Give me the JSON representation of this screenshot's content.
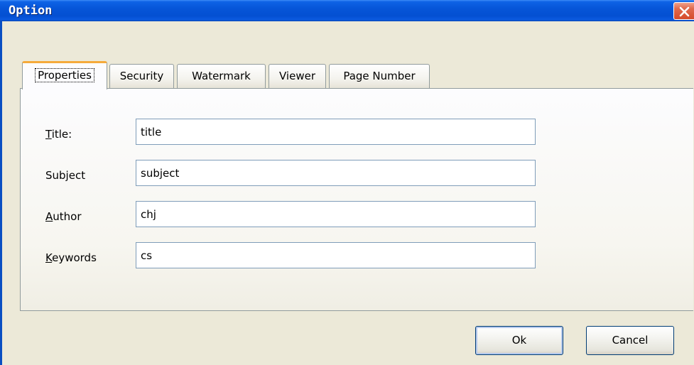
{
  "window": {
    "title": "Option"
  },
  "tabs": [
    {
      "label": "Properties",
      "active": true
    },
    {
      "label": "Security",
      "active": false
    },
    {
      "label": "Watermark",
      "active": false
    },
    {
      "label": "Viewer",
      "active": false
    },
    {
      "label": "Page Number",
      "active": false
    }
  ],
  "fields": [
    {
      "label": "Title:",
      "mnemonic": "T",
      "rest": "itle:",
      "value": "title"
    },
    {
      "label": "Subject",
      "mnemonic": "",
      "rest": "Subject",
      "value": "subject"
    },
    {
      "label": "Author",
      "mnemonic": "A",
      "rest": "uthor",
      "value": "chj"
    },
    {
      "label": "Keywords",
      "mnemonic": "K",
      "rest": "eywords",
      "value": "cs"
    }
  ],
  "buttons": {
    "ok_label": "Ok",
    "cancel_label": "Cancel"
  },
  "icons": {
    "close": "close-icon"
  },
  "colors": {
    "titlebar": "#0655d8",
    "active_tab_accent": "#f5aa3a",
    "close_button": "#d54a2a",
    "dialog_background": "#ece9d8"
  }
}
